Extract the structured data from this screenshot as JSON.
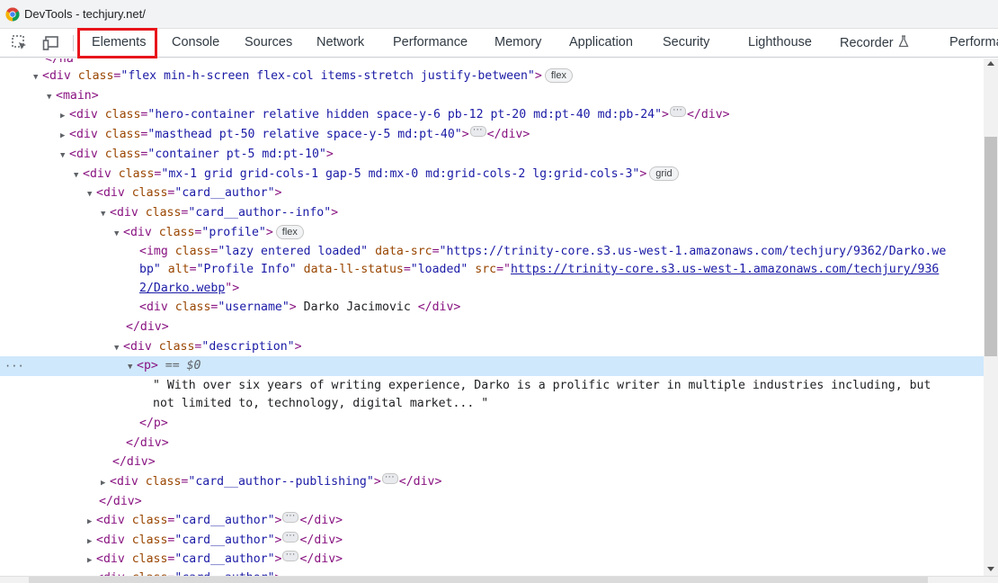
{
  "window": {
    "title": "DevTools - techjury.net/"
  },
  "toolbar": {
    "icons": [
      "inspect-element-icon",
      "device-toolbar-icon"
    ]
  },
  "tabs": [
    {
      "label": "Elements",
      "selected": true
    },
    {
      "label": "Console"
    },
    {
      "label": "Sources"
    },
    {
      "label": "Network"
    },
    {
      "label": "Performance"
    },
    {
      "label": "Memory"
    },
    {
      "label": "Application"
    },
    {
      "label": "Security"
    },
    {
      "label": "Lighthouse"
    },
    {
      "label": "Recorder"
    },
    {
      "label": "Performa"
    }
  ],
  "highlight_color": "#e8151b",
  "dom": {
    "l0": "</ha",
    "l1_tag": "<div",
    "l1_attr": "class",
    "l1_val": "\"flex min-h-screen flex-col items-stretch justify-between\"",
    "l1_end": ">",
    "l1_badge": "flex",
    "l2": "<main>",
    "l3_val": "\"hero-container relative hidden space-y-6 pb-12 pt-20 md:pt-40 md:pb-24\"",
    "l4_val": "\"masthead pt-50 relative space-y-5 md:pt-40\"",
    "l5_val": "\"container pt-5 md:pt-10\"",
    "l6_val": "\"mx-1 grid grid-cols-1 gap-5 md:mx-0 md:grid-cols-2 lg:grid-cols-3\"",
    "l6_badge": "grid",
    "l7_val": "\"card__author\"",
    "l8_val": "\"card__author--info\"",
    "l9_val": "\"profile\"",
    "l9_badge": "flex",
    "l10_img": "<img",
    "l10_a1": "class",
    "l10_v1": "\"lazy entered loaded\"",
    "l10_a2": "data-src",
    "l10_v2a": "\"https://trinity-core.s3.us-west-1.amazonaws.com/techjury/9362/Darko.we",
    "l11_v2b": "bp\"",
    "l11_a3": "alt",
    "l11_v3": "\"Profile Info\"",
    "l11_a4": "data-ll-status",
    "l11_v4": "\"loaded\"",
    "l11_a5": "src",
    "l11_link1": "https://trinity-core.s3.us-west-1.amazonaws.com/techjury/936",
    "l12_link2": "2/Darko.webp",
    "l13_val": "\"username\"",
    "l13_text": " Darko Jacimovic ",
    "close_div": "</div>",
    "close_p": "</p>",
    "close_main_div": "</div>",
    "l15_val": "\"description\"",
    "l16_p": "<p>",
    "l16_eq": " == $0",
    "l17_text": "\" With over six years of writing experience, Darko is a prolific writer in multiple industries including, but",
    "l18_text": "not limited to, technology, digital market... \"",
    "l22_val": "\"card__author--publishing\"",
    "l24_val": "\"card__author\"",
    "sel_dots": "···",
    "ellipsis_label": "···"
  }
}
